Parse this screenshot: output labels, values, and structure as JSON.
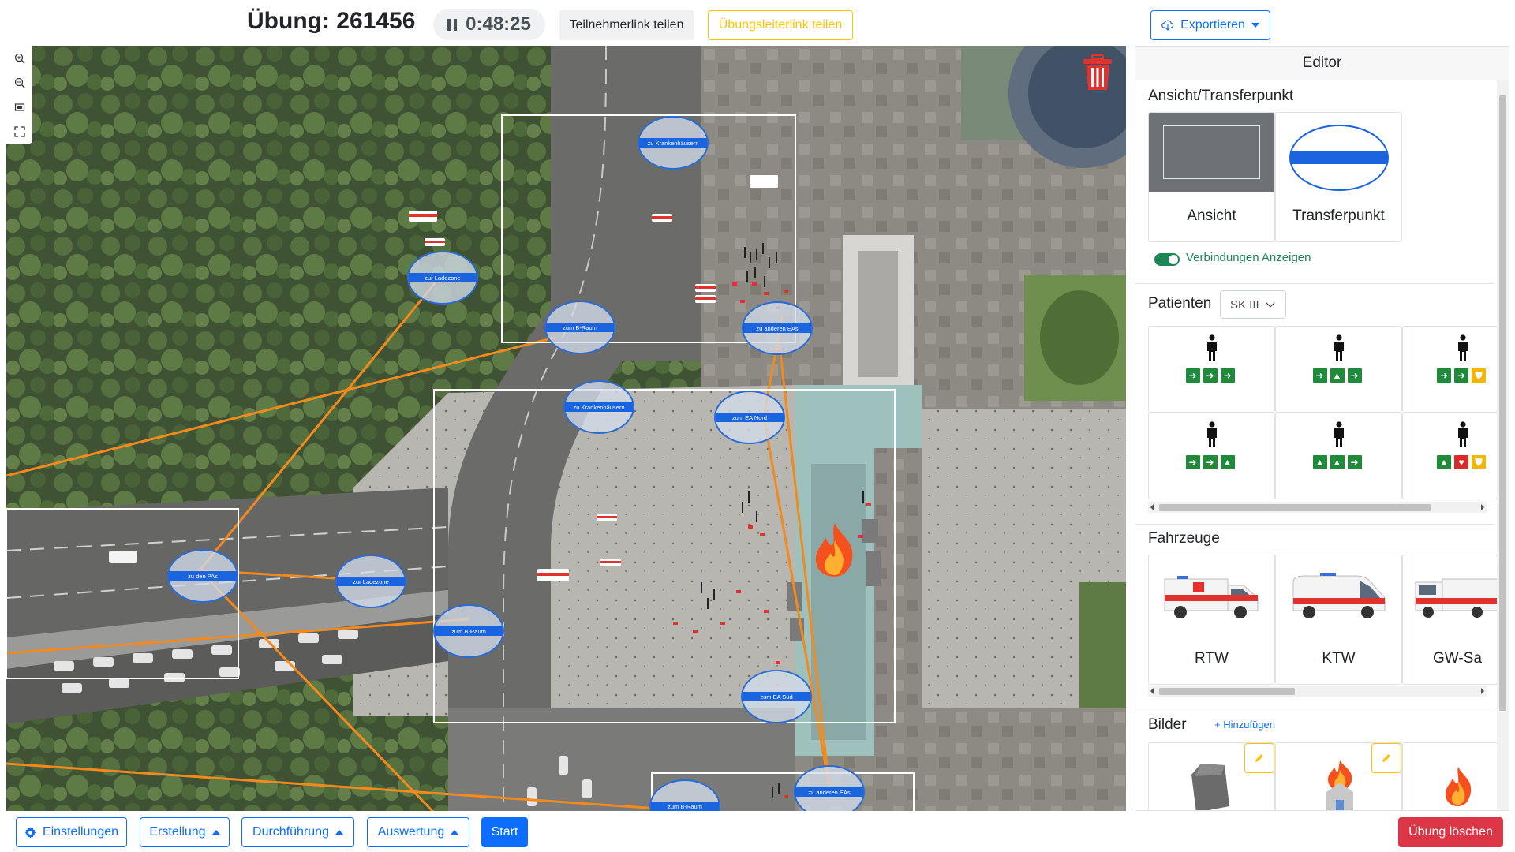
{
  "header": {
    "title": "Übung: 261456",
    "timer": "0:48:25",
    "share_participant": "Teilnehmerlink teilen",
    "share_leader": "Übungsleiterlink teilen",
    "export": "Exportieren"
  },
  "map": {
    "transfer_points": [
      {
        "label": "zu Krankenhäusern"
      },
      {
        "label": "zur Ladezone"
      },
      {
        "label": "zum B-Raum"
      },
      {
        "label": "zu anderen EAs"
      },
      {
        "label": "zu Krankenhäusern"
      },
      {
        "label": "zum EA Nord"
      },
      {
        "label": "zu den PAs"
      },
      {
        "label": "zur Ladezone"
      },
      {
        "label": "zum B-Raum"
      },
      {
        "label": "zum EA Süd"
      },
      {
        "label": "zum B-Raum"
      },
      {
        "label": "zu anderen EAs"
      }
    ],
    "zoom_controls": [
      "zoom-in-icon",
      "zoom-out-icon",
      "fit-icon",
      "fullscreen-icon"
    ]
  },
  "editor": {
    "title": "Editor",
    "view_section": {
      "title": "Ansicht/Transferpunkt",
      "items": [
        {
          "label": "Ansicht"
        },
        {
          "label": "Transferpunkt"
        }
      ],
      "toggle_label": "Verbindungen Anzeigen",
      "toggle_on": true
    },
    "patients": {
      "title": "Patienten",
      "select_value": "SK III",
      "cards": [
        {
          "icons": [
            "arrow",
            "arrow",
            "arrow"
          ]
        },
        {
          "icons": [
            "arrow",
            "warning",
            "arrow"
          ]
        },
        {
          "icons": [
            "arrow",
            "arrow",
            "shield"
          ]
        },
        {
          "icons": [
            "arrow",
            "arrow",
            "warning"
          ]
        },
        {
          "icons": [
            "warning",
            "warning",
            "arrow"
          ]
        },
        {
          "icons": [
            "warning",
            "heart",
            "shield"
          ]
        }
      ]
    },
    "vehicles": {
      "title": "Fahrzeuge",
      "items": [
        {
          "label": "RTW"
        },
        {
          "label": "KTW"
        },
        {
          "label": "GW-Sa"
        }
      ]
    },
    "images": {
      "title": "Bilder",
      "add_label": "+ Hinzufügen",
      "items": [
        "rubble-icon",
        "burning-house-icon",
        "fire-icon"
      ]
    }
  },
  "bottom": {
    "settings": "Einstellungen",
    "creation": "Erstellung",
    "execution": "Durchführung",
    "evaluation": "Auswertung",
    "start": "Start",
    "delete": "Übung löschen"
  },
  "colors": {
    "primary": "#0d6efd",
    "warning": "#ffc107",
    "danger": "#dc3545",
    "success": "#198754",
    "connection": "#f28a1e",
    "transfer_fill": "#1a64e0"
  }
}
